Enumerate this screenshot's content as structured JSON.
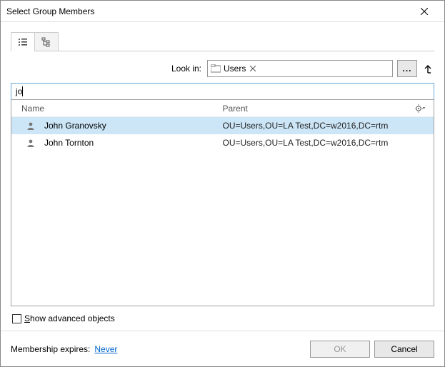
{
  "title": "Select Group Members",
  "lookin_label": "Look in:",
  "lookin_value": "Users",
  "search_value": "jo",
  "columns": {
    "name": "Name",
    "parent": "Parent"
  },
  "rows": [
    {
      "name": "John Granovsky",
      "parent": "OU=Users,OU=LA Test,DC=w2016,DC=rtm",
      "selected": true
    },
    {
      "name": "John Tornton",
      "parent": "OU=Users,OU=LA Test,DC=w2016,DC=rtm",
      "selected": false
    }
  ],
  "advanced_label_pre": "S",
  "advanced_label_rest": "how advanced objects",
  "expires_label": "Membership expires:",
  "expires_value": "Never",
  "ok_label": "OK",
  "cancel_label": "Cancel",
  "icons": {
    "list": "list-icon",
    "tree": "tree-icon",
    "folder": "folder-icon",
    "gear": "gear-icon",
    "user": "user-icon",
    "close": "close-icon",
    "up": "up-arrow-icon",
    "browse": "browse-icon"
  }
}
